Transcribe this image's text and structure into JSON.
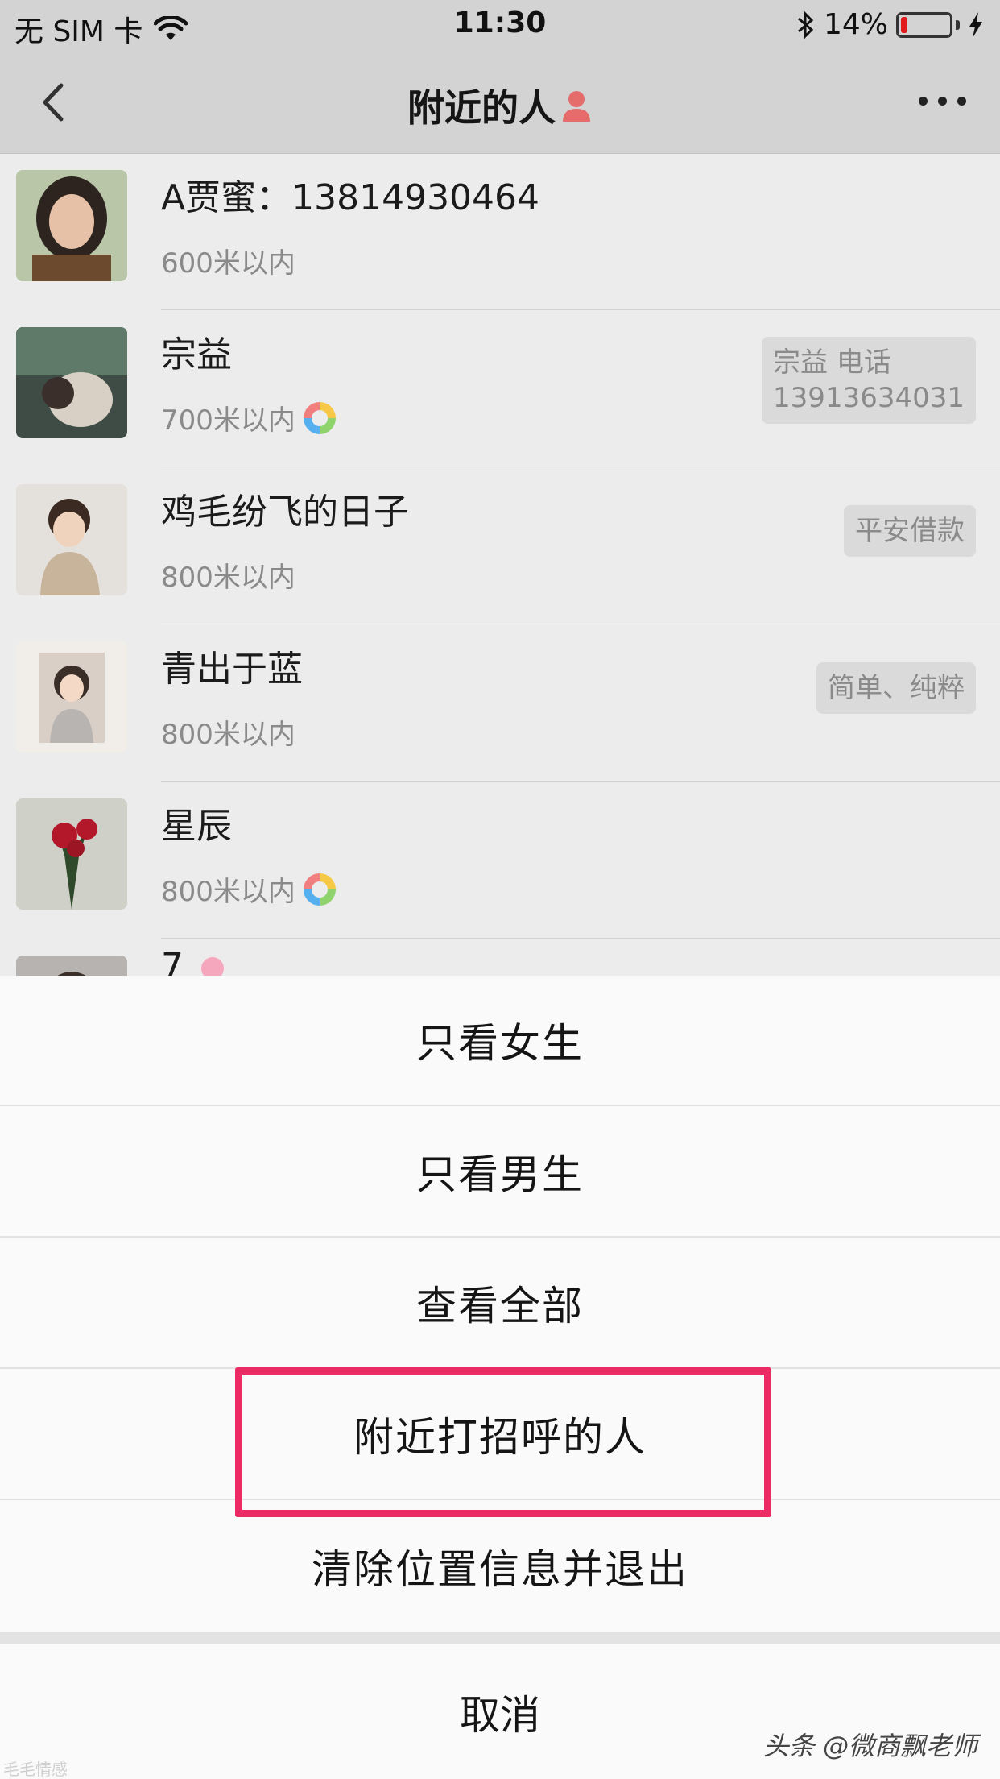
{
  "status_bar": {
    "carrier": "无 SIM 卡",
    "time": "11:30",
    "battery_percent": "14%",
    "battery_level": 0.14,
    "icons": [
      "wifi-icon",
      "bluetooth-icon",
      "battery-icon",
      "charging-icon"
    ]
  },
  "nav": {
    "title": "附近的人",
    "back_icon": "chevron-left-icon",
    "title_icon": "person-icon",
    "more_icon": "more-icon"
  },
  "list": {
    "items": [
      {
        "name": "A贾蜜：13814930464",
        "distance": "600米以内",
        "moments": false,
        "tag": ""
      },
      {
        "name": "宗益",
        "distance": "700米以内",
        "moments": true,
        "tag": "宗益  电话\n13913634031"
      },
      {
        "name": "鸡毛纷飞的日子",
        "distance": "800米以内",
        "moments": false,
        "tag": "平安借款"
      },
      {
        "name": "青出于蓝",
        "distance": "800米以内",
        "moments": false,
        "tag": "简单、纯粹"
      },
      {
        "name": "星辰",
        "distance": "800米以内",
        "moments": true,
        "tag": ""
      },
      {
        "name": "7",
        "distance": "",
        "moments": false,
        "tag": ""
      }
    ]
  },
  "action_sheet": {
    "options": [
      "只看女生",
      "只看男生",
      "查看全部",
      "附近打招呼的人",
      "清除位置信息并退出"
    ],
    "cancel": "取消",
    "highlighted_option": "附近打招呼的人",
    "highlight_color": "#ec2a63"
  },
  "watermark": {
    "right": "头条 @微商飘老师",
    "left": "毛毛情感"
  },
  "colors": {
    "overlay": "#d3d3d3",
    "battery_low": "#e01b1b",
    "distance_text": "#8a8a8a"
  }
}
